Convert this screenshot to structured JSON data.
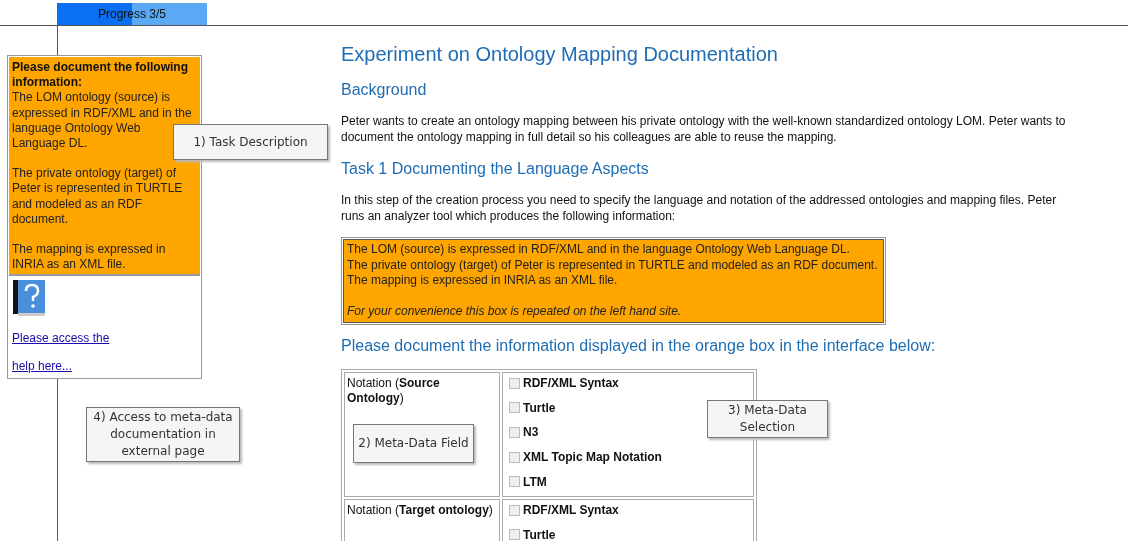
{
  "progress": {
    "label": "Progress 3/5",
    "level": 0.5
  },
  "sidebar": {
    "heading": "Please document the following information:",
    "paragraphs": [
      "The LOM ontology (source) is expressed in RDF/XML and in the language Ontology Web Language DL.",
      "The private ontology (target) of Peter is represented in TURTLE and modeled as an RDF document.",
      "The mapping is expressed in INRIA as an XML file."
    ],
    "links": [
      "Please access the",
      "help here..."
    ]
  },
  "main": {
    "title": "Experiment on Ontology Mapping Documentation",
    "sections": [
      {
        "heading": "Background",
        "text": "Peter wants to create an ontology mapping between his private ontology with the well-known standardized ontology LOM. Peter wants to document the ontology mapping in full detail so his colleagues are able to reuse the mapping."
      },
      {
        "heading": "Task 1 Documenting the Language Aspects",
        "text": "In this step of the creation process you need to specify the language and notation of the addressed ontologies and mapping files. Peter runs an analyzer tool which produces the following information:"
      }
    ],
    "info_box": {
      "lines": [
        "The LOM (source) is expressed in RDF/XML and in the language Ontology Web Language DL.",
        "The private ontology (target) of Peter is represented in TURTLE and modeled as an RDF document.",
        "The mapping is expressed in INRIA as an XML file."
      ],
      "note": "For your convenience this box is repeated on the left hand site."
    },
    "form_heading": "Please document the information displayed in the orange box in the interface below:",
    "fields": [
      {
        "label": "Notation (**Source Ontology**)",
        "options": [
          {
            "label": "RDF/XML Syntax",
            "checked": false
          },
          {
            "label": "Turtle",
            "checked": false
          },
          {
            "label": "N3",
            "checked": false
          },
          {
            "label": "XML Topic Map Notation",
            "checked": false
          },
          {
            "label": "LTM",
            "checked": false
          }
        ]
      },
      {
        "label": "Notation (**Target ontology**)",
        "options": [
          {
            "label": "RDF/XML Syntax",
            "checked": false
          },
          {
            "label": "Turtle",
            "checked": false
          }
        ]
      }
    ]
  },
  "callouts": [
    "1) Task Description",
    "2) Meta-Data Field",
    "3) Meta-Data Selection",
    "4) Access to meta-data documentation in external page"
  ]
}
